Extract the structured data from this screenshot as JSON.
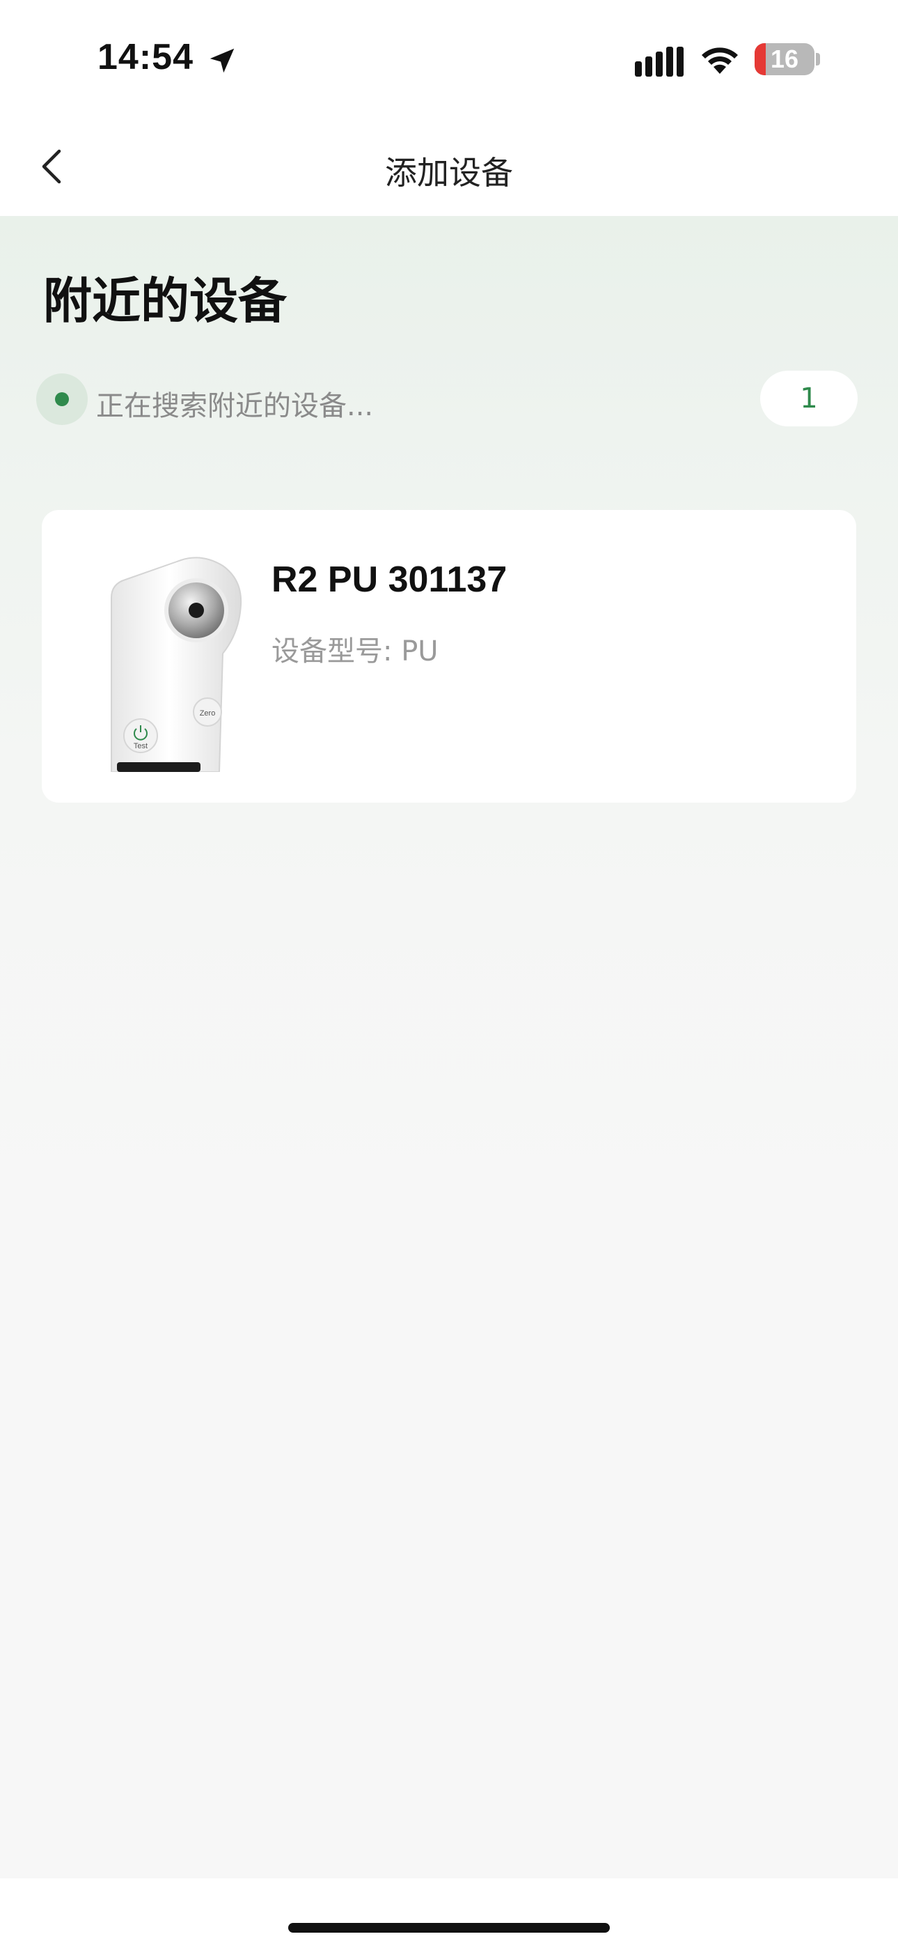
{
  "status_bar": {
    "time": "14:54",
    "battery_level": "16",
    "icons": [
      "location-arrow-icon",
      "cellular-signal-icon",
      "wifi-icon",
      "battery-icon"
    ]
  },
  "nav": {
    "title": "添加设备",
    "back_icon": "chevron-left-icon"
  },
  "main": {
    "section_title": "附近的设备",
    "search_status": "正在搜索附近的设备...",
    "device_count": "1",
    "devices": [
      {
        "name": "R2 PU 301137",
        "model": "设备型号: PU",
        "image_icon": "refractometer-device-image",
        "image_labels": [
          "Zero",
          "Test"
        ]
      }
    ]
  },
  "colors": {
    "accent_green": "#2f8a4c",
    "battery_low": "#e53935"
  }
}
